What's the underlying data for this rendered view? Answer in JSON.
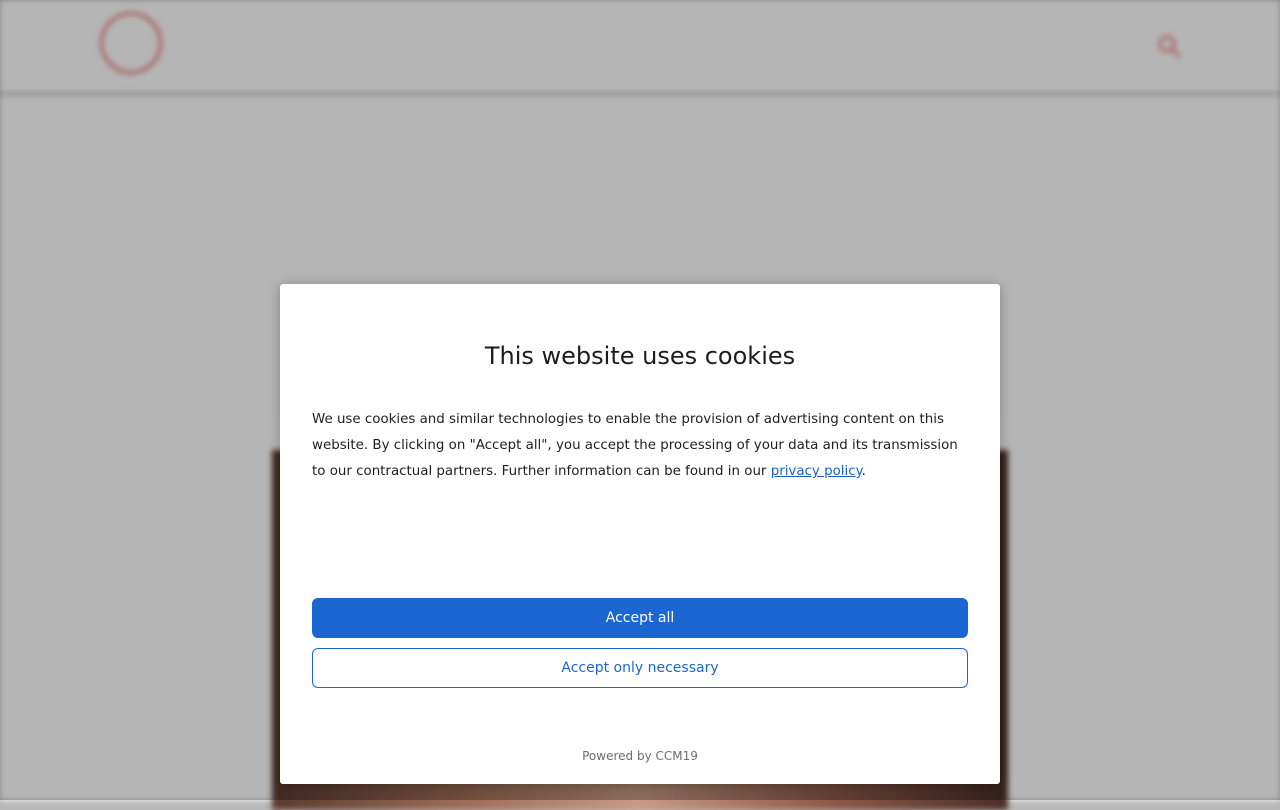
{
  "background_page": {
    "logo": {
      "wordmark": "",
      "subtitle": ""
    },
    "nav": [
      "",
      "",
      "",
      ""
    ],
    "article_title": ""
  },
  "cookie_dialog": {
    "title": "This website uses cookies",
    "body_text": "We use cookies and similar technologies to enable the provision of advertising content on this website. By clicking on \"Accept all\", you accept the processing of your data and its transmission to our contractual partners. Further information can be found in our ",
    "privacy_link_label": "privacy policy",
    "body_text_end": ".",
    "accept_all_label": "Accept all",
    "accept_necessary_label": "Accept only necessary",
    "powered_by": "Powered by CCM19"
  },
  "colors": {
    "primary_button": "#1a67d2",
    "link": "#1565c0",
    "logo_red": "#e2453f",
    "nav_blue": "#55b7e0"
  },
  "icons": {
    "header_search": "search-icon",
    "logo_mark": "logo-circle-icon"
  }
}
